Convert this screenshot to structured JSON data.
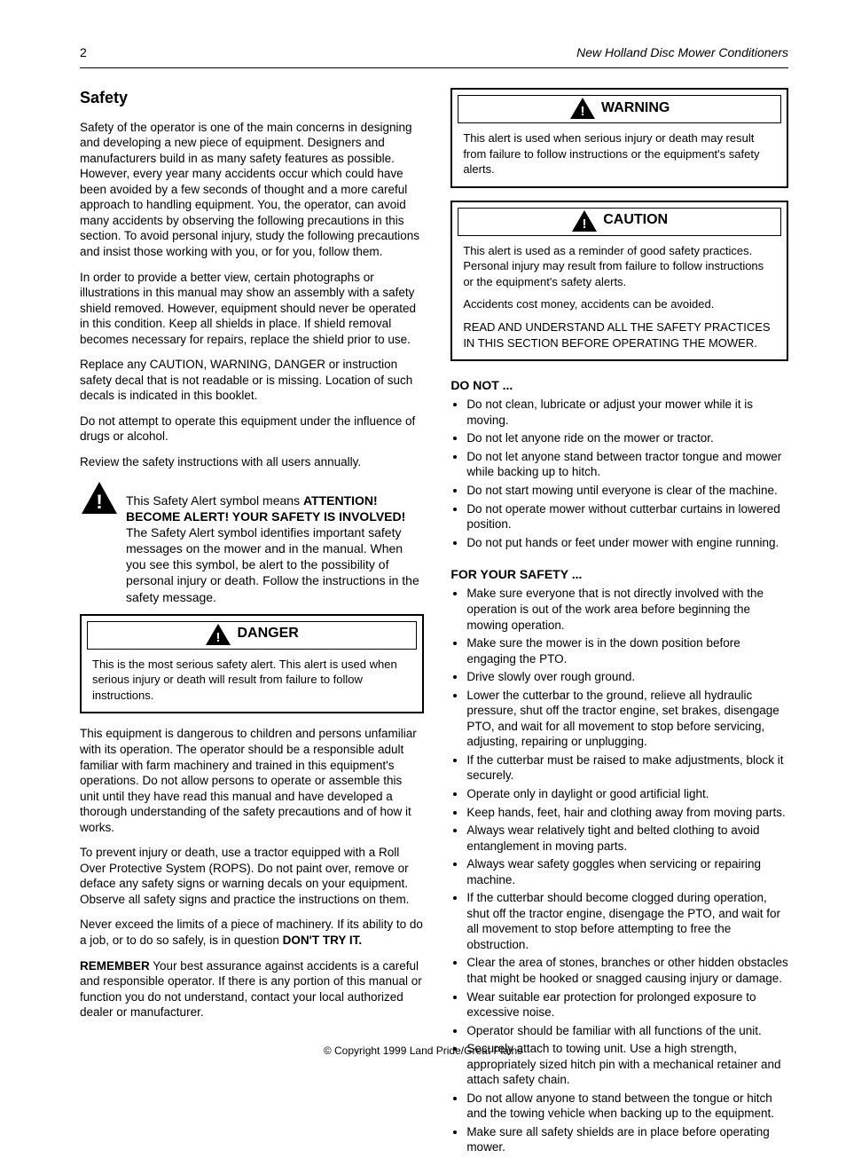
{
  "header": {
    "page_number": "2",
    "title": "New Holland Disc Mower Conditioners"
  },
  "left": {
    "section_title": "Safety",
    "p1": "Safety of the operator is one of the main concerns in designing and developing a new piece of equipment. Designers and manufacturers build in as many safety features as possible. However, every year many accidents occur which could have been avoided by a few seconds of thought and a more careful approach to handling equipment. You, the operator, can avoid many accidents by observing the following precautions in this section. To avoid personal injury, study the following precautions and insist those working with you, or for you, follow them.",
    "p2": "In order to provide a better view, certain photographs or illustrations in this manual may show an assembly with a safety shield removed. However, equipment should never be operated in this condition. Keep all shields in place. If shield removal becomes necessary for repairs, replace the shield prior to use.",
    "p3": "Replace any CAUTION, WARNING, DANGER or instruction safety decal that is not readable or is missing. Location of such decals is indicated in this booklet.",
    "p4": "Do not attempt to operate this equipment under the influence of drugs or alcohol.",
    "p5": "Review the safety instructions with all users annually.",
    "inline_alert": {
      "lead": "This Safety Alert symbol means",
      "strong": "ATTENTION! BECOME ALERT! YOUR SAFETY IS INVOLVED!",
      "tail": "The Safety Alert symbol identifies important safety messages on the mower and in the manual. When you see this symbol, be alert to the possibility of personal injury or death. Follow the instructions in the safety message."
    },
    "alert1": {
      "label": "DANGER",
      "body": "This is the most serious safety alert. This alert is used when serious injury or death will result from failure to follow instructions."
    },
    "p6": "This equipment is dangerous to children and persons unfamiliar with its operation. The operator should be a responsible adult familiar with farm machinery and trained in this equipment's operations. Do not allow persons to operate or assemble this unit until they have read this manual and have developed a thorough understanding of the safety precautions and of how it works.",
    "p7": "To prevent injury or death, use a tractor equipped with a Roll Over Protective System (ROPS). Do not paint over, remove or deface any safety signs or warning decals on your equipment. Observe all safety signs and practice the instructions on them.",
    "p8": "Never exceed the limits of a piece of machinery. If its ability to do a job, or to do so safely, is in question",
    "strong_dont": "DON'T TRY IT.",
    "remember_label": "REMEMBER",
    "remember_body": "Your best assurance against accidents is a careful and responsible operator. If there is any portion of this manual or function you do not understand, contact your local authorized dealer or manufacturer."
  },
  "right": {
    "alert2": {
      "label": "WARNING",
      "body": "This alert is used when serious injury or death may result from failure to follow instructions or the equipment's safety alerts."
    },
    "alert3": {
      "label": "CAUTION",
      "body_p1": "This alert is used as a reminder of good safety practices. Personal injury may result from failure to follow instructions or the equipment's safety alerts.",
      "body_p2": "Accidents cost money, accidents can be avoided.",
      "body_p3": "READ AND UNDERSTAND ALL THE SAFETY PRACTICES IN THIS SECTION BEFORE OPERATING THE MOWER."
    },
    "do_not_head": "DO NOT ...",
    "do_not_items": [
      "Do not clean, lubricate or adjust your mower while it is moving.",
      "Do not let anyone ride on the mower or tractor.",
      "Do not let anyone stand between tractor tongue and mower while backing up to hitch.",
      "Do not start mowing until everyone is clear of the machine.",
      "Do not operate mower without cutterbar curtains in lowered position.",
      "Do not put hands or feet under mower with engine running."
    ],
    "safety_head": "FOR YOUR SAFETY ...",
    "safety_items": [
      "Make sure everyone that is not directly involved with the operation is out of the work area before beginning the mowing operation.",
      "Make sure the mower is in the down position before engaging the PTO.",
      "Drive slowly over rough ground.",
      "Lower the cutterbar to the ground, relieve all hydraulic pressure, shut off the tractor engine, set brakes, disengage PTO, and wait for all movement to stop before servicing, adjusting, repairing or unplugging.",
      "If the cutterbar must be raised to make adjustments, block it securely.",
      "Operate only in daylight or good artificial light.",
      "Keep hands, feet, hair and clothing away from moving parts.",
      "Always wear relatively tight and belted clothing to avoid entanglement in moving parts.",
      "Always wear safety goggles when servicing or repairing machine.",
      "If the cutterbar should become clogged during operation, shut off the tractor engine, disengage the PTO, and wait for all movement to stop before attempting to free the obstruction.",
      "Clear the area of stones, branches or other hidden obstacles that might be hooked or snagged causing injury or damage.",
      "Wear suitable ear protection for prolonged exposure to excessive noise.",
      "Operator should be familiar with all functions of the unit.",
      "Securely attach to towing unit. Use a high strength, appropriately sized hitch pin with a mechanical retainer and attach safety chain.",
      "Do not allow anyone to stand between the tongue or hitch and the towing vehicle when backing up to the equipment.",
      "Make sure all safety shields are in place before operating mower."
    ]
  },
  "footer": "© Copyright 1999 Land Pride/Great Plains"
}
